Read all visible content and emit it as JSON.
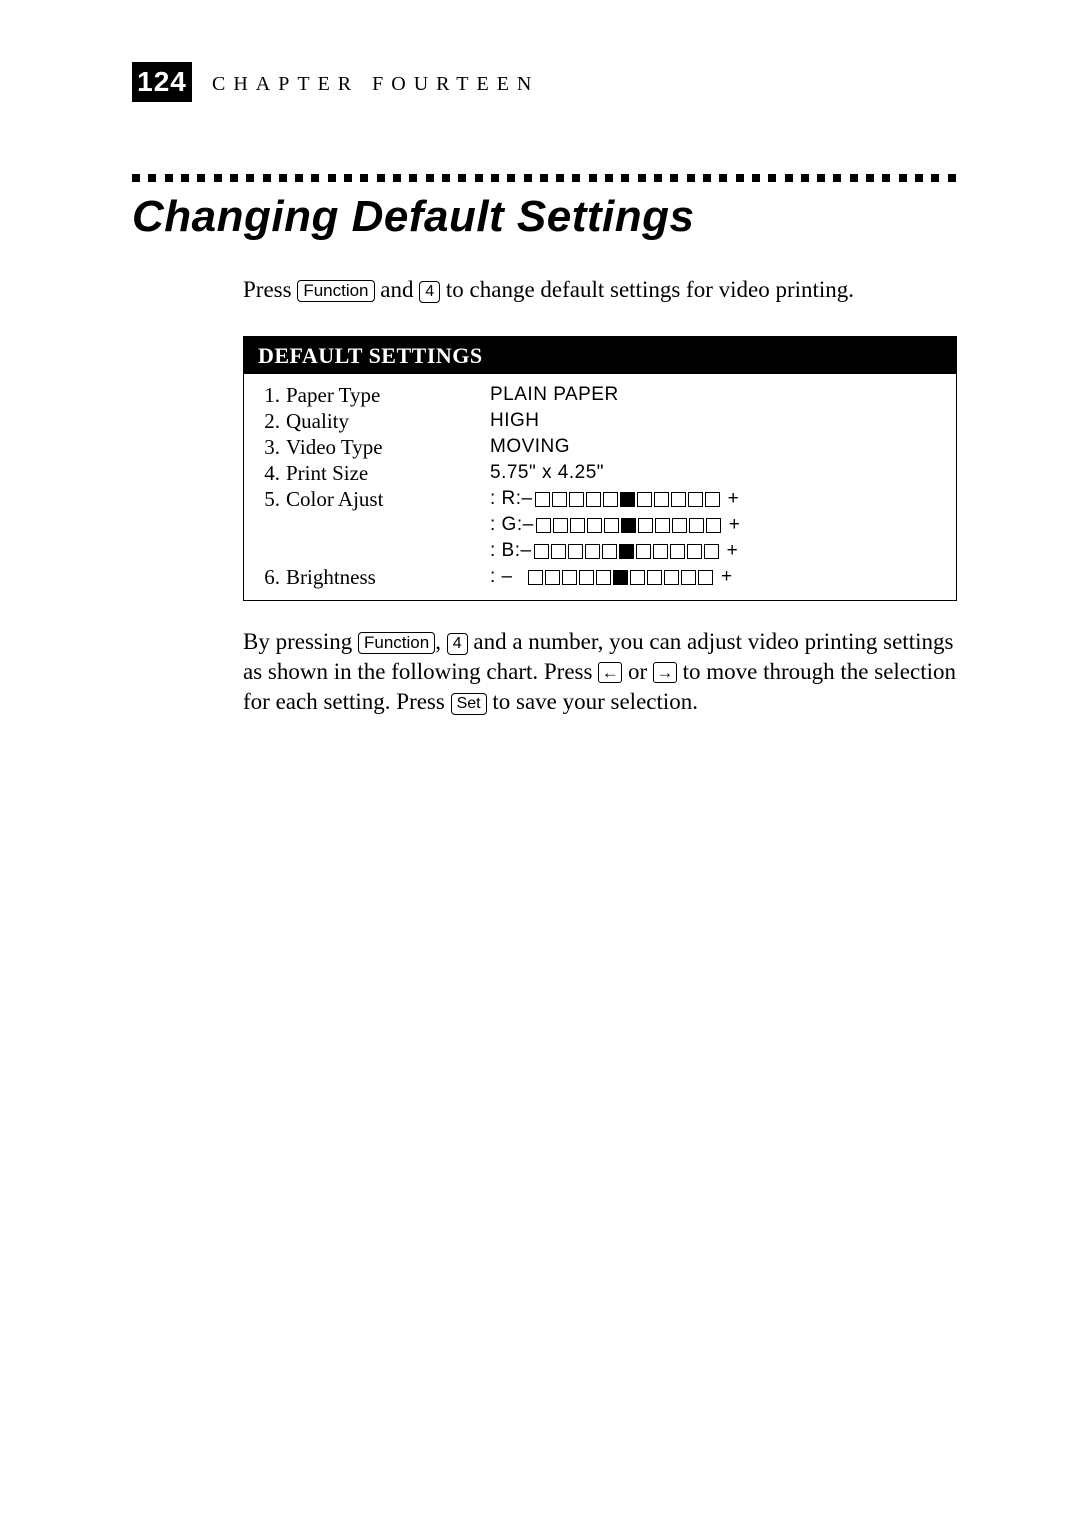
{
  "page_number": "124",
  "chapter_label": "CHAPTER FOURTEEN",
  "heading": "Changing Default Settings",
  "intro": {
    "press": "Press ",
    "function_key": "Function",
    "and": " and ",
    "four_key": "4",
    "rest": " to change default settings for video printing."
  },
  "settings": {
    "header": "DEFAULT SETTINGS",
    "rows": [
      {
        "num": "1.",
        "name": "Paper Type",
        "value": "PLAIN PAPER"
      },
      {
        "num": "2.",
        "name": "Quality",
        "value": "HIGH"
      },
      {
        "num": "3.",
        "name": "Video Type",
        "value": "MOVING"
      },
      {
        "num": "4.",
        "name": "Print Size",
        "value": "5.75\" x 4.25\""
      }
    ],
    "color_row": {
      "num": "5.",
      "name": "Color Ajust"
    },
    "color_sliders": [
      {
        "label": ": R:–",
        "filled_index": 5
      },
      {
        "label": ": G:–",
        "filled_index": 5
      },
      {
        "label": ": B:–",
        "filled_index": 5
      }
    ],
    "brightness_row": {
      "num": "6.",
      "name": "Brightness"
    },
    "brightness_slider": {
      "label": ": –",
      "filled_index": 5
    },
    "slider_plus": "+"
  },
  "para": {
    "t1": "By  pressing ",
    "function_key": "Function",
    "t2": ", ",
    "four_key": "4",
    "t3": " and a number, you can adjust video printing settings as shown in the following chart. Press ",
    "left_arrow": "←",
    "t4": " or ",
    "right_arrow": "→",
    "t5": " to move through the selection for each setting. Press ",
    "set_key": "Set",
    "t6": " to save your selection."
  }
}
